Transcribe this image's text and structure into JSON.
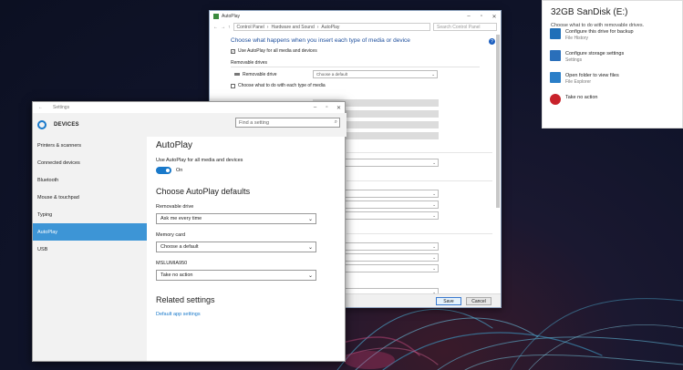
{
  "control_panel": {
    "title": "AutoPlay",
    "breadcrumb": [
      "Control Panel",
      "Hardware and Sound",
      "AutoPlay"
    ],
    "search_placeholder": "Search Control Panel",
    "heading": "Choose what happens when you insert each type of media or device",
    "use_autoplay": "Use AutoPlay for all media and devices",
    "section_removable": "Removable drives",
    "removable_drive": "Removable drive",
    "removable_drive_value": "Choose a default",
    "choose_each": "Choose what to do with each type of media",
    "save": "Save",
    "cancel": "Cancel"
  },
  "toast": {
    "title": "32GB SanDisk (E:)",
    "subtitle": "Choose what to do with removable drives.",
    "items": [
      {
        "title": "Configure this drive for backup",
        "sub": "File History",
        "icon": "backup-icon",
        "color": "#1f6fb8"
      },
      {
        "title": "Configure storage settings",
        "sub": "Settings",
        "icon": "storage-settings-icon",
        "color": "#2a6fba"
      },
      {
        "title": "Open folder to view files",
        "sub": "File Explorer",
        "icon": "folder-icon",
        "color": "#2a7ec8"
      },
      {
        "title": "Take no action",
        "sub": "",
        "icon": "no-action-icon",
        "color": "#c8222b"
      }
    ]
  },
  "settings": {
    "window_title": "Settings",
    "header": "DEVICES",
    "search_placeholder": "Find a setting",
    "nav": [
      "Printers & scanners",
      "Connected devices",
      "Bluetooth",
      "Mouse & touchpad",
      "Typing",
      "AutoPlay",
      "USB"
    ],
    "active_nav": "AutoPlay",
    "page_title": "AutoPlay",
    "use_autoplay_label": "Use AutoPlay for all media and devices",
    "toggle_state": "On",
    "defaults_heading": "Choose AutoPlay defaults",
    "fields": [
      {
        "label": "Removable drive",
        "value": "Ask me every time"
      },
      {
        "label": "Memory card",
        "value": "Choose a default"
      },
      {
        "label": "MSLUMIA950",
        "value": "Take no action"
      }
    ],
    "related_heading": "Related settings",
    "related_link": "Default app settings"
  }
}
